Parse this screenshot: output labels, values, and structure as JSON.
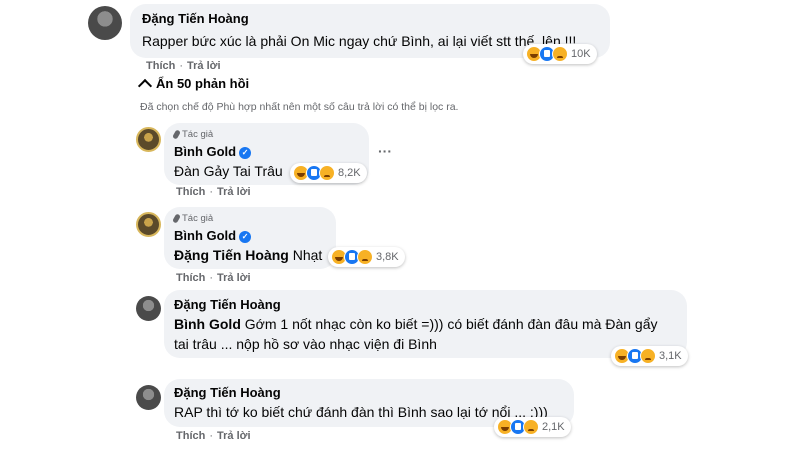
{
  "comment": {
    "author": "Đặng Tiến Hoàng",
    "text": "Rapper bức xúc là phải On Mic ngay chứ Bình, ai lại viết stt thế, lên !!!",
    "reaction_count": "10K",
    "like_label": "Thích",
    "reply_label": "Trả lời"
  },
  "thread": {
    "hide_label": "Ẩn 50 phản hồi",
    "filter_note": "Đã chọn chế độ Phù hợp nhất nên một số câu trả lời có thể bị lọc ra."
  },
  "replies": [
    {
      "author_tag": "Tác giả",
      "author": "Bình Gold",
      "text": "Đàn Gảy Tai Trâu",
      "reaction_count": "8,2K",
      "like_label": "Thích",
      "reply_label": "Trả lời",
      "more_label": "···"
    },
    {
      "author_tag": "Tác giả",
      "author": "Bình Gold",
      "mention": "Đặng Tiến Hoàng",
      "text": "Nhạt",
      "reaction_count": "3,8K",
      "like_label": "Thích",
      "reply_label": "Trả lời"
    },
    {
      "author": "Đặng Tiến Hoàng",
      "mention": "Bình Gold",
      "text_line1": "Gớm 1 nốt nhạc còn ko biết =))) có biết đánh đàn đâu mà Đàn gẩy",
      "text_line2": "tai trâu ... nộp hồ sơ vào nhạc viện đi Bình",
      "reaction_count": "3,1K",
      "like_label": "Thích",
      "reply_label": "Trả lời"
    },
    {
      "author": "Đặng Tiến Hoàng",
      "text": "RAP thì tớ ko biết chứ đánh đàn thì Bình sao lại tớ nổi ... :)))",
      "reaction_count": "2,1K",
      "like_label": "Thích",
      "reply_label": "Trả lời"
    }
  ],
  "icons": {
    "hide_chevron": "chevron-up-icon",
    "author_badge": "microphone-icon",
    "verified": "verified-check-icon",
    "reactions": [
      "haha-icon",
      "like-icon",
      "sad-icon"
    ]
  },
  "colors": {
    "bubble": "#f0f2f5",
    "secondary_text": "#65676b",
    "verified": "#1877f2"
  }
}
